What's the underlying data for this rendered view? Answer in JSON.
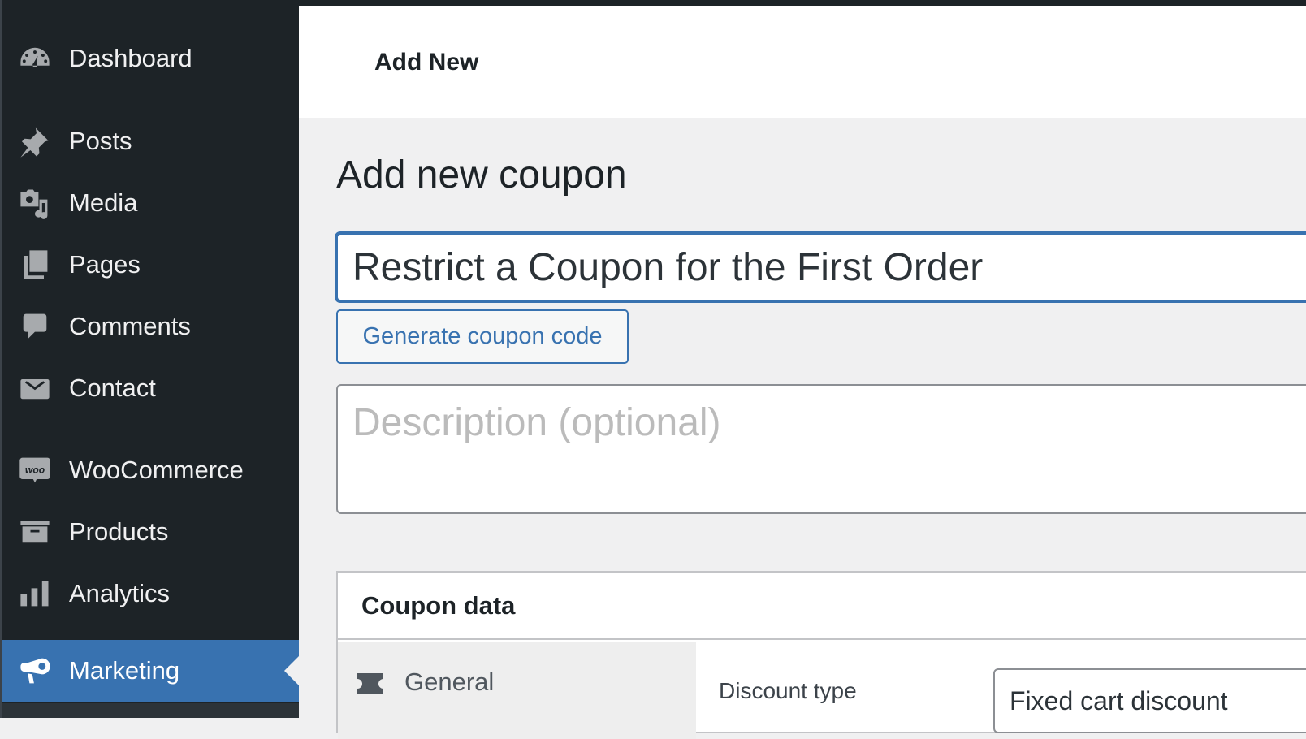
{
  "sidebar": {
    "items": [
      {
        "label": "Dashboard",
        "icon": "dashboard-icon"
      },
      {
        "label": "Posts",
        "icon": "pin-icon"
      },
      {
        "label": "Media",
        "icon": "media-icon"
      },
      {
        "label": "Pages",
        "icon": "pages-icon"
      },
      {
        "label": "Comments",
        "icon": "comment-icon"
      },
      {
        "label": "Contact",
        "icon": "mail-icon"
      },
      {
        "label": "WooCommerce",
        "icon": "woo-icon"
      },
      {
        "label": "Products",
        "icon": "archive-icon"
      },
      {
        "label": "Analytics",
        "icon": "bar-chart-icon"
      },
      {
        "label": "Marketing",
        "icon": "megaphone-icon",
        "active": true
      }
    ],
    "active_color": "#3872b0"
  },
  "header": {
    "title": "Add New"
  },
  "page": {
    "heading": "Add new coupon",
    "coupon_title_value": "Restrict a Coupon for the First Order",
    "generate_button_label": "Generate coupon code",
    "description_placeholder": "Description (optional)"
  },
  "coupon_data": {
    "title": "Coupon data",
    "tabs": [
      {
        "label": "General",
        "icon": "ticket-icon"
      }
    ],
    "fields": {
      "discount_type_label": "Discount type",
      "discount_type_value": "Fixed cart discount"
    }
  }
}
